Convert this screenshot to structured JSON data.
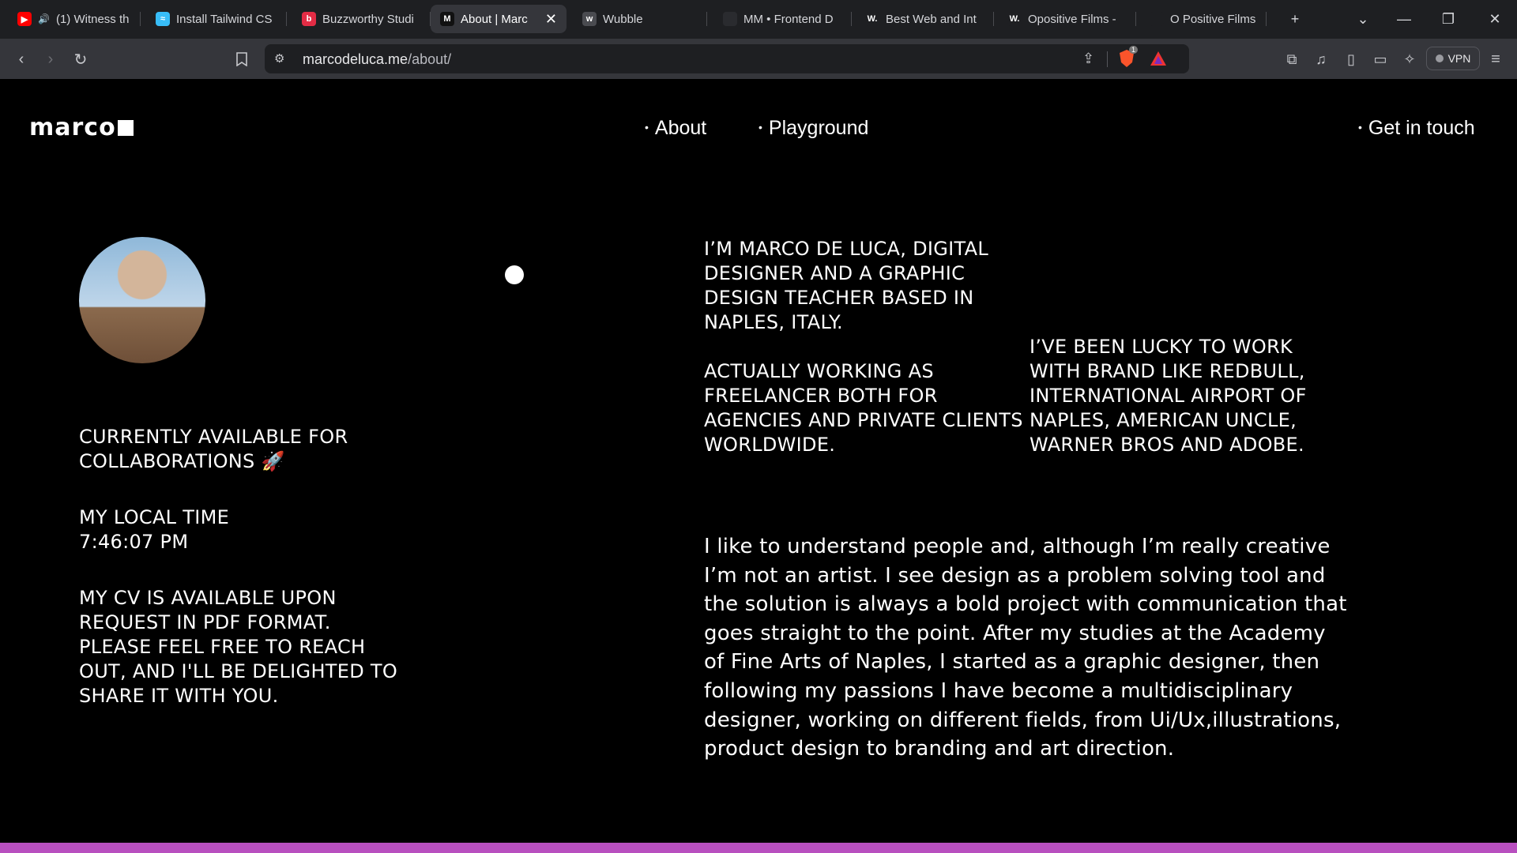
{
  "browser": {
    "tabs": [
      {
        "title": "(1) Witness th",
        "favicon": "youtube-icon",
        "color": "#ff0000",
        "glyph": "▶",
        "audio": true
      },
      {
        "title": "Install Tailwind CS",
        "favicon": "tailwind-icon",
        "color": "#38bdf8",
        "glyph": "≈"
      },
      {
        "title": "Buzzworthy Studi",
        "favicon": "buzzworthy-icon",
        "color": "#e32c45",
        "glyph": "b"
      },
      {
        "title": "About | Marc",
        "favicon": "marco-icon",
        "color": "#111111",
        "glyph": "M",
        "active": true
      },
      {
        "title": "Wubble",
        "favicon": "wubble-icon",
        "color": "#4a4b50",
        "glyph": "w"
      },
      {
        "title": "MM • Frontend D",
        "favicon": "mm-icon",
        "color": "#2a2b2f",
        "glyph": ""
      },
      {
        "title": "Best Web and Int",
        "favicon": "webflow-w-icon",
        "color": "#1e1f22",
        "glyph": "W."
      },
      {
        "title": "Opositive Films -",
        "favicon": "webflow-w-icon",
        "color": "#1e1f22",
        "glyph": "W."
      },
      {
        "title": "O Positive Films",
        "favicon": "opositive-icon",
        "color": "#1e1f22",
        "glyph": ""
      }
    ],
    "url_domain": "marcodeluca.me",
    "url_path": "/about/",
    "vpn_label": "VPN",
    "shield_count": "1"
  },
  "site": {
    "logo": "marco",
    "nav": {
      "about": "About",
      "playground": "Playground",
      "contact": "Get in touch"
    }
  },
  "left": {
    "availability": "Currently available for\ncollaborations 🚀",
    "time_label": "My local time",
    "time_value": "7:46:07 PM",
    "cv": "My CV is available upon\nrequest in PDF format.\nPlease feel free to reach\nout, and I'll be delighted to\nshare  it with you."
  },
  "right": {
    "intro": "I’m Marco De Luca, digital\ndesigner and a graphic\ndesign teacher based in\nNaples, Italy.",
    "freelance": "Actually working as\nfreelancer both for\nagencies and private clients\nworldwide.",
    "brands": "I’ve been lucky to work\nwith brand like Redbull,\nInternational Airport of\nNaples, American Uncle,\nWarner Bros and Adobe.",
    "bio": "I like to understand people and, although I’m really creative I’m not an artist. I see design as a problem solving tool and the solution is always a bold project with communication that goes straight to the point. After my studies at the Academy of Fine Arts of Naples, I started as a graphic designer, then following my passions I have become a multidisciplinary designer, working on different fields, from Ui/Ux,illustrations, product design to branding and art direction."
  },
  "colors": {
    "accent_bar": "#b84fbf",
    "background": "#000000"
  }
}
